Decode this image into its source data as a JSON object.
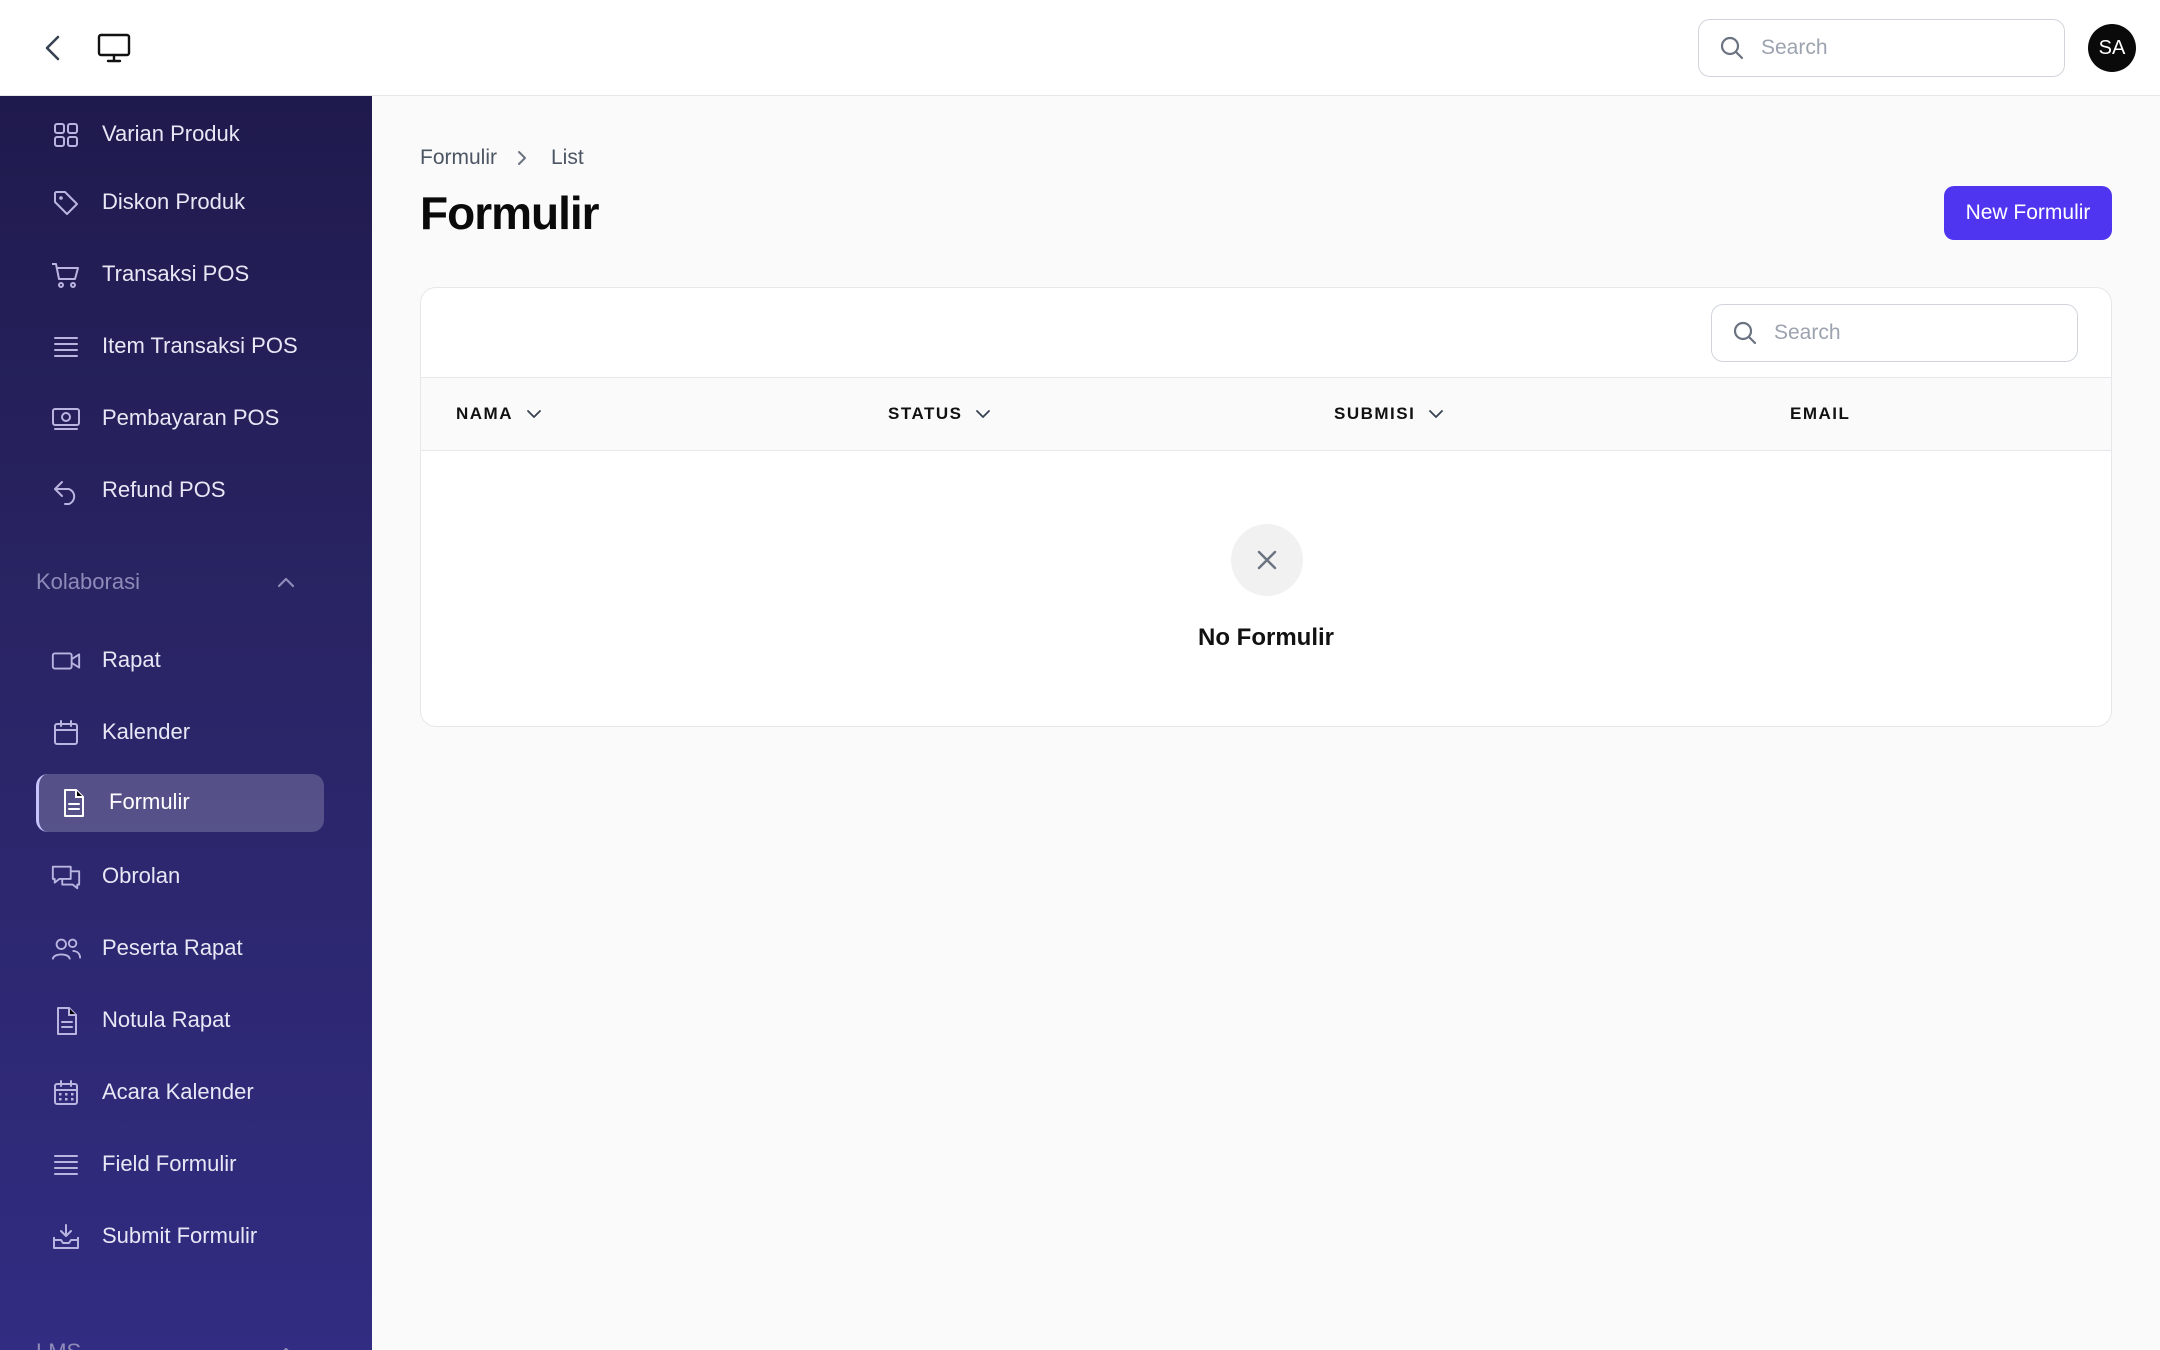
{
  "topbar": {
    "search_placeholder": "Search",
    "avatar_initials": "SA"
  },
  "sidebar": {
    "items_top": [
      {
        "label": "Varian Produk",
        "icon": "grid-icon"
      },
      {
        "label": "Diskon Produk",
        "icon": "tag-icon"
      },
      {
        "label": "Transaksi POS",
        "icon": "cart-icon"
      },
      {
        "label": "Item Transaksi POS",
        "icon": "list-icon"
      },
      {
        "label": "Pembayaran POS",
        "icon": "cash-icon"
      },
      {
        "label": "Refund POS",
        "icon": "undo-icon"
      }
    ],
    "group_kolaborasi": "Kolaborasi",
    "items_kolaborasi": [
      {
        "label": "Rapat",
        "icon": "video-icon"
      },
      {
        "label": "Kalender",
        "icon": "calendar-icon"
      },
      {
        "label": "Formulir",
        "icon": "document-icon",
        "active": true
      },
      {
        "label": "Obrolan",
        "icon": "chat-icon"
      },
      {
        "label": "Peserta Rapat",
        "icon": "users-icon"
      },
      {
        "label": "Notula Rapat",
        "icon": "document-icon"
      },
      {
        "label": "Acara Kalender",
        "icon": "calendar-days-icon"
      },
      {
        "label": "Field Formulir",
        "icon": "list-icon"
      },
      {
        "label": "Submit Formulir",
        "icon": "inbox-download-icon"
      }
    ],
    "group_next": "LMS"
  },
  "main": {
    "breadcrumb": [
      "Formulir",
      "List"
    ],
    "title": "Formulir",
    "new_button": "New Formulir",
    "table": {
      "search_placeholder": "Search",
      "columns": [
        {
          "label": "NAMA",
          "sortable": true
        },
        {
          "label": "STATUS",
          "sortable": true
        },
        {
          "label": "SUBMISI",
          "sortable": true
        },
        {
          "label": "EMAIL",
          "sortable": false
        }
      ],
      "empty_text": "No Formulir"
    }
  },
  "colors": {
    "accent": "#4f35f0",
    "sidebar_top": "#1f1a4d",
    "sidebar_bottom": "#322c82"
  }
}
